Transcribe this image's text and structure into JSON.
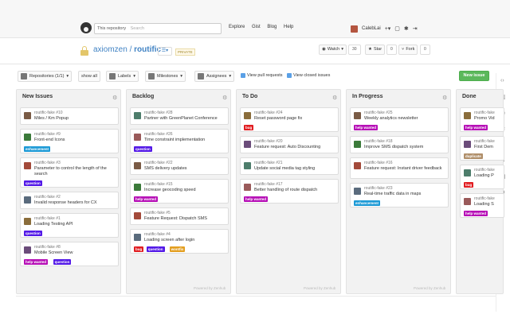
{
  "header": {
    "search_scope": "This repository",
    "search_placeholder": "Search",
    "nav": [
      "Explore",
      "Gist",
      "Blog",
      "Help"
    ],
    "user": "CalebLai"
  },
  "repo": {
    "owner": "axiomzen",
    "separator": "/",
    "name": "routific",
    "private_badge": "PRIVATE",
    "watch_label": "Watch",
    "watch_count": "30",
    "star_label": "Star",
    "star_count": "0",
    "fork_label": "Fork",
    "fork_count": "0"
  },
  "toolbar": {
    "repositories": "Repositories (1/1)",
    "show_all": "show all",
    "labels": "Labels",
    "milestones": "Milestones",
    "assignees": "Assignees",
    "view_pulls": "View pull requests",
    "view_closed": "View closed issues",
    "new_issue": "New issue"
  },
  "colors": {
    "question": "#5319e7",
    "enhancement": "#1d9ad6",
    "help_wanted": "#b60fb6",
    "bug": "#e11d21",
    "wontfix": "#e39e1f",
    "duplicate": "#b08f6a",
    "new_issue_button": "#5cb85c"
  },
  "columns": [
    {
      "title": "New Issues",
      "footer": "",
      "cards": [
        {
          "num": "routific-fake #10",
          "title": "Miles / Km Popup",
          "labels": []
        },
        {
          "num": "routific-fake #9",
          "title": "Front-end Icons",
          "labels": [
            {
              "text": "enhancement",
              "kind": "enhancement"
            }
          ]
        },
        {
          "num": "routific-fake #3",
          "title": "Parameter to control the length of the search",
          "labels": [
            {
              "text": "question",
              "kind": "question"
            }
          ]
        },
        {
          "num": "routific-fake #2",
          "title": "Invalid response headers for CX",
          "labels": []
        },
        {
          "num": "routific-fake #1",
          "title": "Loading Testing API",
          "labels": [
            {
              "text": "question",
              "kind": "question"
            }
          ]
        },
        {
          "num": "routific-fake #8",
          "title": "Mobile Screen View",
          "labels": [
            {
              "text": "help wanted",
              "kind": "help_wanted"
            },
            {
              "text": "question",
              "kind": "question"
            }
          ]
        }
      ]
    },
    {
      "title": "Backlog",
      "footer": "Powered by Zenhub",
      "cards": [
        {
          "num": "routific-fake #28",
          "title": "Partner with GreenPlanet Conference",
          "labels": []
        },
        {
          "num": "routific-fake #26",
          "title": "Time constraint implementation",
          "labels": [
            {
              "text": "question",
              "kind": "question"
            }
          ]
        },
        {
          "num": "routific-fake #22",
          "title": "SMS delivery updates",
          "labels": []
        },
        {
          "num": "routific-fake #15",
          "title": "Increase geocoding speed",
          "labels": [
            {
              "text": "help wanted",
              "kind": "help_wanted"
            }
          ]
        },
        {
          "num": "routific-fake #5",
          "title": "Feature Request: Dispatch SMS",
          "labels": []
        },
        {
          "num": "routific-fake #4",
          "title": "Loading screen after login",
          "labels": [
            {
              "text": "bug",
              "kind": "bug"
            },
            {
              "text": "question",
              "kind": "question"
            },
            {
              "text": "wontfix",
              "kind": "wontfix"
            }
          ]
        }
      ]
    },
    {
      "title": "To Do",
      "footer": "Powered by Zenhub",
      "cards": [
        {
          "num": "routific-fake #24",
          "title": "Reset password page fix",
          "labels": [
            {
              "text": "bug",
              "kind": "bug"
            }
          ]
        },
        {
          "num": "routific-fake #20",
          "title": "Feature request: Auto Discounting",
          "labels": []
        },
        {
          "num": "routific-fake #21",
          "title": "Update social media tag styling",
          "labels": []
        },
        {
          "num": "routific-fake #17",
          "title": "Better handling of route dispatch",
          "labels": [
            {
              "text": "help wanted",
              "kind": "help_wanted"
            }
          ]
        }
      ]
    },
    {
      "title": "In Progress",
      "footer": "Powered by Zenhub",
      "cards": [
        {
          "num": "routific-fake #25",
          "title": "Weekly analytics newsletter",
          "labels": [
            {
              "text": "help wanted",
              "kind": "help_wanted"
            }
          ]
        },
        {
          "num": "routific-fake #18",
          "title": "Improve SMS dispatch system",
          "labels": []
        },
        {
          "num": "routific-fake #16",
          "title": "Feature request: Instant driver feedback",
          "labels": []
        },
        {
          "num": "routific-fake #23",
          "title": "Real-time traffic data in maps",
          "labels": [
            {
              "text": "enhancement",
              "kind": "enhancement"
            }
          ]
        }
      ]
    },
    {
      "title": "Done",
      "footer": "",
      "cards": [
        {
          "num": "routific-fake",
          "title": "Promo Vid",
          "labels": [
            {
              "text": "help wanted",
              "kind": "help_wanted"
            }
          ]
        },
        {
          "num": "routific-fake",
          "title": "First Dem",
          "labels": [
            {
              "text": "duplicate",
              "kind": "duplicate"
            }
          ]
        },
        {
          "num": "routific-fake",
          "title": "Loading P",
          "labels": [
            {
              "text": "bug",
              "kind": "bug"
            }
          ]
        },
        {
          "num": "routific-fake",
          "title": "Loading S",
          "labels": [
            {
              "text": "help wanted",
              "kind": "help_wanted"
            }
          ]
        }
      ]
    }
  ]
}
